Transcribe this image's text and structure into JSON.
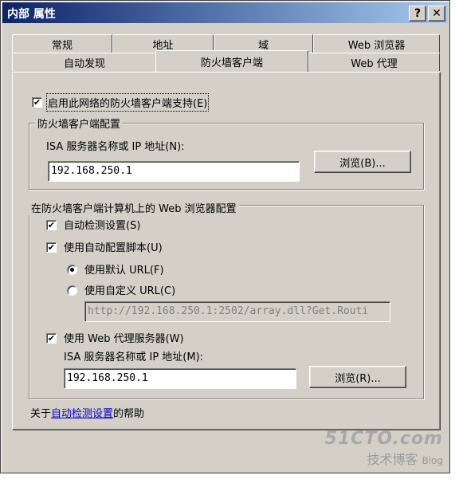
{
  "window": {
    "title": "内部 属性",
    "help_button": "?",
    "close_button": "✕"
  },
  "tabs_row1": [
    "常规",
    "地址",
    "域",
    "Web 浏览器"
  ],
  "tabs_row2": [
    "自动发现",
    "防火墙客户端",
    "Web 代理"
  ],
  "active_tab": "防火墙客户端",
  "enable_support": {
    "label": "启用此网络的防火墙客户端支持(E)",
    "checked": "✔"
  },
  "fw_config": {
    "title": "防火墙客户端配置",
    "server_label": "ISA 服务器名称或 IP 地址(N):",
    "server_value": "192.168.250.1",
    "browse_label": "浏览(B)..."
  },
  "web_config": {
    "title": "在防火墙客户端计算机上的 Web 浏览器配置",
    "auto_detect": {
      "label": "自动检测设置(S)",
      "checked": "✔"
    },
    "auto_script": {
      "label": "使用自动配置脚本(U)",
      "checked": "✔"
    },
    "use_default_url": "使用默认 URL(F)",
    "use_custom_url": "使用自定义 URL(C)",
    "custom_url_value": "http://192.168.250.1:2502/array.dll?Get.Routi",
    "use_proxy": {
      "label": "使用 Web 代理服务器(W)",
      "checked": "✔"
    },
    "proxy_label": "ISA 服务器名称或 IP 地址(M):",
    "proxy_value": "192.168.250.1",
    "browse_label": "浏览(R)..."
  },
  "help_text": {
    "prefix": "关于",
    "link": "自动检测设置",
    "suffix": "的帮助"
  },
  "watermark": {
    "brand": "51CTO.com",
    "sub": "技术博客",
    "blog": "Blog"
  }
}
